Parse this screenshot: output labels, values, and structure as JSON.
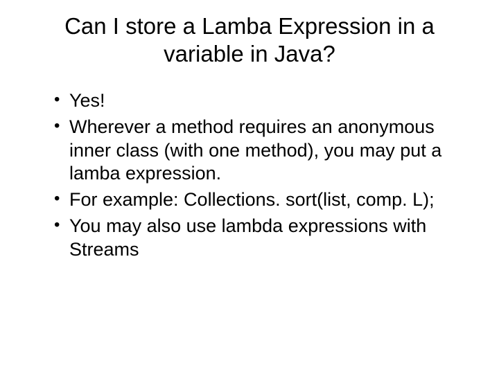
{
  "title": "Can I store a Lamba Expression in a variable in Java?",
  "bullets": [
    "Yes!",
    "Wherever a method requires an anonymous inner class (with one method), you may put a lamba expression.",
    "For example:  Collections. sort(list, comp. L);",
    "You may also use lambda expressions with Streams"
  ]
}
